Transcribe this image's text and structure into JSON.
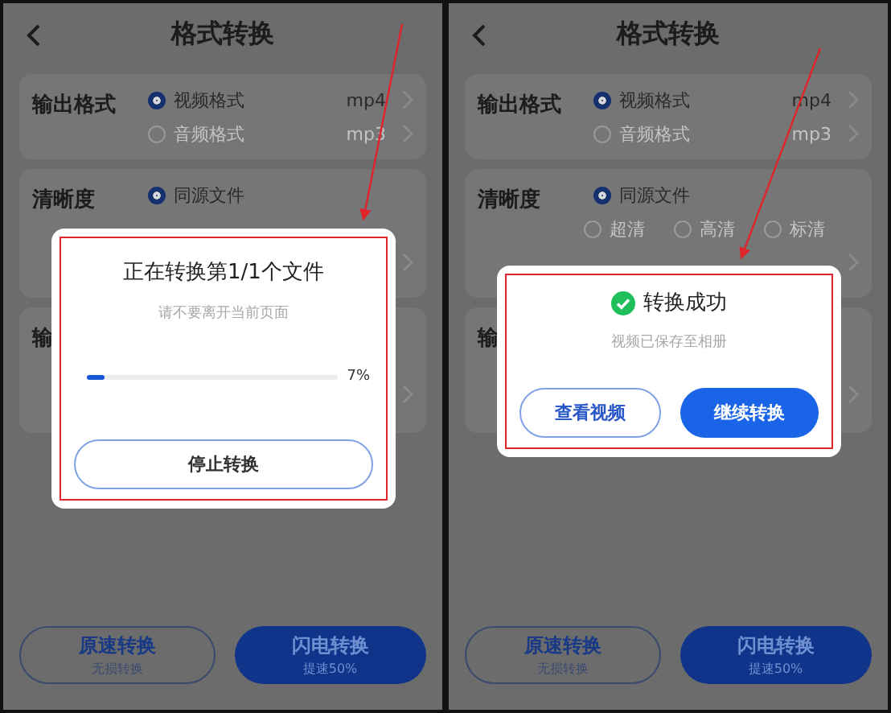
{
  "screens": [
    {
      "title": "格式转换",
      "sections": [
        {
          "label": "输出格式",
          "options": [
            {
              "label": "视频格式",
              "value": "mp4",
              "selected": true
            },
            {
              "label": "音频格式",
              "value": "mp3",
              "selected": false
            }
          ]
        },
        {
          "label": "清晰度",
          "options": [
            {
              "label": "同源文件",
              "selected": true
            }
          ]
        },
        {
          "label": "输"
        }
      ],
      "actions": [
        {
          "title": "原速转换",
          "subtitle": "无损转换",
          "primary": false
        },
        {
          "title": "闪电转换",
          "subtitle": "提速50%",
          "primary": true
        }
      ],
      "dialog": {
        "kind": "progress",
        "title": "正在转换第1/1个文件",
        "message": "请不要离开当前页面",
        "level": 0.07,
        "reading": "7%",
        "buttons": [
          {
            "label": "停止转换",
            "primary": false
          }
        ]
      }
    },
    {
      "title": "格式转换",
      "sections": [
        {
          "label": "输出格式",
          "options": [
            {
              "label": "视频格式",
              "value": "mp4",
              "selected": true
            },
            {
              "label": "音频格式",
              "value": "mp3",
              "selected": false
            }
          ]
        },
        {
          "label": "清晰度",
          "options": [
            {
              "label": "同源文件",
              "selected": true
            }
          ],
          "choices": [
            {
              "label": "超清",
              "selected": false
            },
            {
              "label": "高清",
              "selected": false
            },
            {
              "label": "标清",
              "selected": false
            }
          ]
        },
        {
          "label": "输"
        }
      ],
      "actions": [
        {
          "title": "原速转换",
          "subtitle": "无损转换",
          "primary": false
        },
        {
          "title": "闪电转换",
          "subtitle": "提速50%",
          "primary": true
        }
      ],
      "dialog": {
        "kind": "success",
        "title": "转换成功",
        "message": "视频已保存至相册",
        "buttons": [
          {
            "label": "查看视频",
            "primary": false
          },
          {
            "label": "继续转换",
            "primary": true
          }
        ]
      }
    }
  ]
}
